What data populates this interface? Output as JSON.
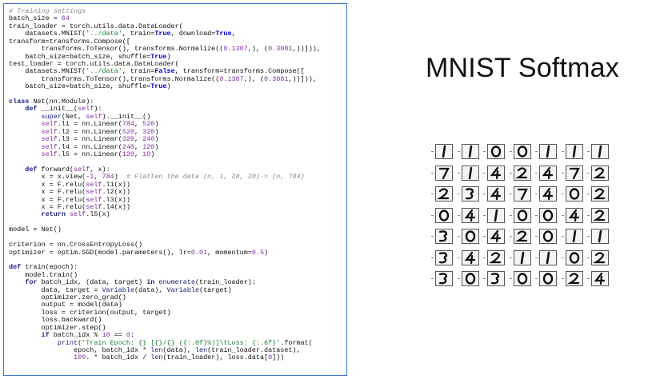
{
  "slide": {
    "title": "MNIST Softmax"
  },
  "code": {
    "lines": [
      "# Training settings",
      "batch_size = 64",
      "train_loader = torch.utils.data.DataLoader(",
      "    datasets.MNIST('../data', train=True, download=True,",
      "transform=transforms.Compose([",
      "        transforms.ToTensor(), transforms.Normalize((0.1307,), (0.3081,))])),",
      "    batch_size=batch_size, shuffle=True)",
      "test_loader = torch.utils.data.DataLoader(",
      "    datasets.MNIST('../data', train=False, transform=transforms.Compose([",
      "        transforms.ToTensor(),transforms.Normalize((0.1307,), (0.3081,))])),",
      "    batch_size=batch_size, shuffle=True)",
      "",
      "class Net(nn.Module):",
      "    def __init__(self):",
      "        super(Net, self).__init__()",
      "        self.l1 = nn.Linear(784, 520)",
      "        self.l2 = nn.Linear(520, 320)",
      "        self.l3 = nn.Linear(320, 240)",
      "        self.l4 = nn.Linear(240, 120)",
      "        self.l5 = nn.Linear(120, 10)",
      "",
      "    def forward(self, x):",
      "        x = x.view(-1, 784)  # Flatten the data (n, 1, 28, 28)-> (n, 784)",
      "        x = F.relu(self.l1(x))",
      "        x = F.relu(self.l2(x))",
      "        x = F.relu(self.l3(x))",
      "        x = F.relu(self.l4(x))",
      "        return self.l5(x)",
      "",
      "model = Net()",
      "",
      "criterion = nn.CrossEntropyLoss()",
      "optimizer = optim.SGD(model.parameters(), lr=0.01, momentum=0.5)",
      "",
      "def train(epoch):",
      "    model.train()",
      "    for batch_idx, (data, target) in enumerate(train_loader):",
      "        data, target = Variable(data), Variable(target)",
      "        optimizer.zero_grad()",
      "        output = model(data)",
      "        loss = criterion(output, target)",
      "        loss.backward()",
      "        optimizer.step()",
      "        if batch_idx % 10 == 0:",
      "            print('Train Epoch: {} [{}/{} ({:.0f}%)]\\tLoss: {:.6f}'.format(",
      "                epoch, batch_idx * len(data), len(train_loader.dataset),",
      "                100. * batch_idx / len(train_loader), loss.data[0]))"
    ]
  },
  "digit_grid": {
    "rows": [
      [
        "1",
        "1",
        "0",
        "0",
        "1",
        "1",
        "1"
      ],
      [
        "7",
        "1",
        "4",
        "2",
        "4",
        "7",
        "2"
      ],
      [
        "2",
        "3",
        "4",
        "7",
        "4",
        "0",
        "2"
      ],
      [
        "0",
        "4",
        "1",
        "0",
        "0",
        "4",
        "2"
      ],
      [
        "3",
        "0",
        "4",
        "2",
        "0",
        "1",
        "1"
      ],
      [
        "3",
        "4",
        "2",
        "1",
        "1",
        "0",
        "2"
      ],
      [
        "3",
        "0",
        "3",
        "0",
        "0",
        "2",
        "4"
      ]
    ]
  }
}
